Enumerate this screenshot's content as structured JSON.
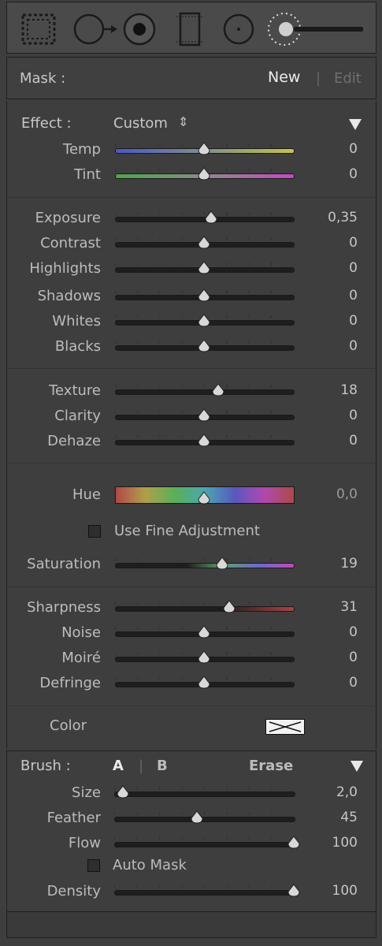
{
  "toolbar": {
    "tools": [
      "graduated-filter-icon",
      "spot-removal-icon",
      "red-eye-icon",
      "crop-icon",
      "radial-filter-icon",
      "adjustment-brush-icon"
    ]
  },
  "mask": {
    "label": "Mask :",
    "new_label": "New",
    "divider": "|",
    "edit_label": "Edit"
  },
  "effect": {
    "label": "Effect :",
    "value": "Custom",
    "spinner": "⇕"
  },
  "groups": {
    "wb": [
      {
        "label": "Temp",
        "value": "0",
        "pos": 0.5,
        "track": "temp"
      },
      {
        "label": "Tint",
        "value": "0",
        "pos": 0.5,
        "track": "tint"
      }
    ],
    "tone": [
      {
        "label": "Exposure",
        "value": "0,35",
        "pos": 0.54,
        "track": "gray"
      },
      {
        "label": "Contrast",
        "value": "0",
        "pos": 0.5,
        "track": "gray"
      },
      {
        "label": "Highlights",
        "value": "0",
        "pos": 0.5,
        "track": "gray"
      },
      {
        "label": "Shadows",
        "value": "0",
        "pos": 0.5,
        "track": "gray"
      },
      {
        "label": "Whites",
        "value": "0",
        "pos": 0.5,
        "track": "gray"
      },
      {
        "label": "Blacks",
        "value": "0",
        "pos": 0.5,
        "track": "gray"
      }
    ],
    "presence": [
      {
        "label": "Texture",
        "value": "18",
        "pos": 0.58,
        "track": "gray"
      },
      {
        "label": "Clarity",
        "value": "0",
        "pos": 0.5,
        "track": "gray"
      },
      {
        "label": "Dehaze",
        "value": "0",
        "pos": 0.5,
        "track": "gray"
      }
    ],
    "hue": {
      "label": "Hue",
      "value": "0,0",
      "pos": 0.5
    },
    "fine": {
      "label": "Use Fine Adjustment"
    },
    "saturation": {
      "label": "Saturation",
      "value": "19",
      "pos": 0.6
    },
    "detail": [
      {
        "label": "Sharpness",
        "value": "31",
        "pos": 0.64,
        "track": "sharp"
      },
      {
        "label": "Noise",
        "value": "0",
        "pos": 0.5,
        "track": "gray"
      },
      {
        "label": "Moiré",
        "value": "0",
        "pos": 0.5,
        "track": "gray"
      },
      {
        "label": "Defringe",
        "value": "0",
        "pos": 0.5,
        "track": "gray"
      }
    ],
    "color": {
      "label": "Color"
    }
  },
  "brush": {
    "label": "Brush :",
    "a_label": "A",
    "divider": "|",
    "b_label": "B",
    "erase_label": "Erase",
    "sliders": [
      {
        "label": "Size",
        "value": "2,0",
        "pos": 0.05
      },
      {
        "label": "Feather",
        "value": "45",
        "pos": 0.46
      },
      {
        "label": "Flow",
        "value": "100",
        "pos": 1.0
      }
    ],
    "auto_mask": "Auto Mask",
    "density": {
      "label": "Density",
      "value": "100",
      "pos": 1.0
    }
  }
}
